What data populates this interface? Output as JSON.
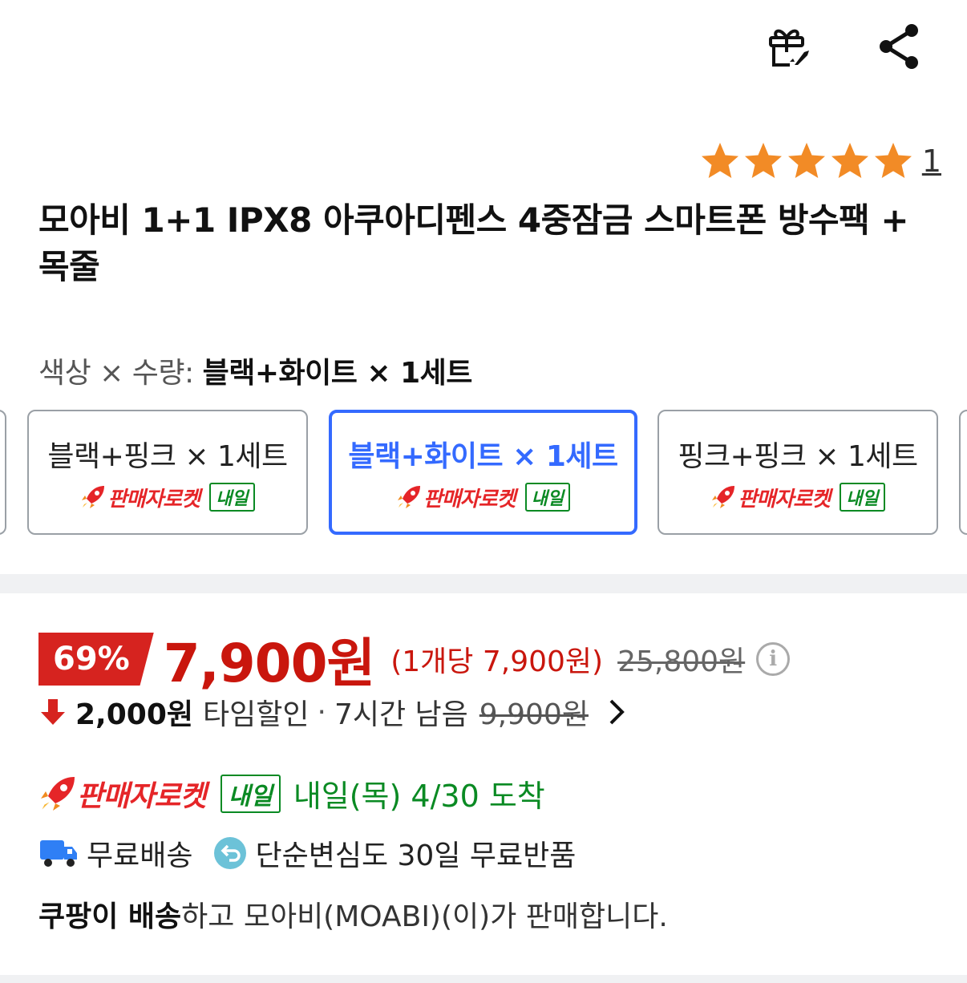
{
  "header": {
    "gift_icon": "gift-rocket-icon",
    "share_icon": "share-icon"
  },
  "rating": {
    "stars": 5,
    "max_stars": 5,
    "star_color": "#f28b26",
    "count": "1"
  },
  "product": {
    "title": "모아비 1+1 IPX8 아쿠아디펜스 4중잠금 스마트폰 방수팩 + 목줄"
  },
  "options": {
    "label_prefix": "색상 × 수량: ",
    "selected_value": "블랙+화이트 × 1세트",
    "items": [
      {
        "name": "블랙+핑크 × 1세트",
        "rocket": "판매자로켓",
        "tag": "내일"
      },
      {
        "name": "블랙+화이트 × 1세트",
        "rocket": "판매자로켓",
        "tag": "내일"
      },
      {
        "name": "핑크+핑크 × 1세트",
        "rocket": "판매자로켓",
        "tag": "내일"
      }
    ]
  },
  "price": {
    "discount": "69%",
    "sale_price": "7,900원",
    "unit_price": "(1개당 7,900원)",
    "original_price": "25,800원",
    "accent_color": "#c9160d"
  },
  "timedeal": {
    "amount": "2,000원",
    "label": "타임할인",
    "separator": "·",
    "remaining": "7시간 남음",
    "before_price": "9,900원"
  },
  "delivery": {
    "rocket": "판매자로켓",
    "tag": "내일",
    "arrival": "내일(목) 4/30 도착",
    "free_shipping": "무료배송",
    "return_policy": "단순변심도 30일 무료반품"
  },
  "seller": {
    "bold": "쿠팡이 배송",
    "rest": "하고 모아비(MOABI)(이)가 판매합니다."
  }
}
